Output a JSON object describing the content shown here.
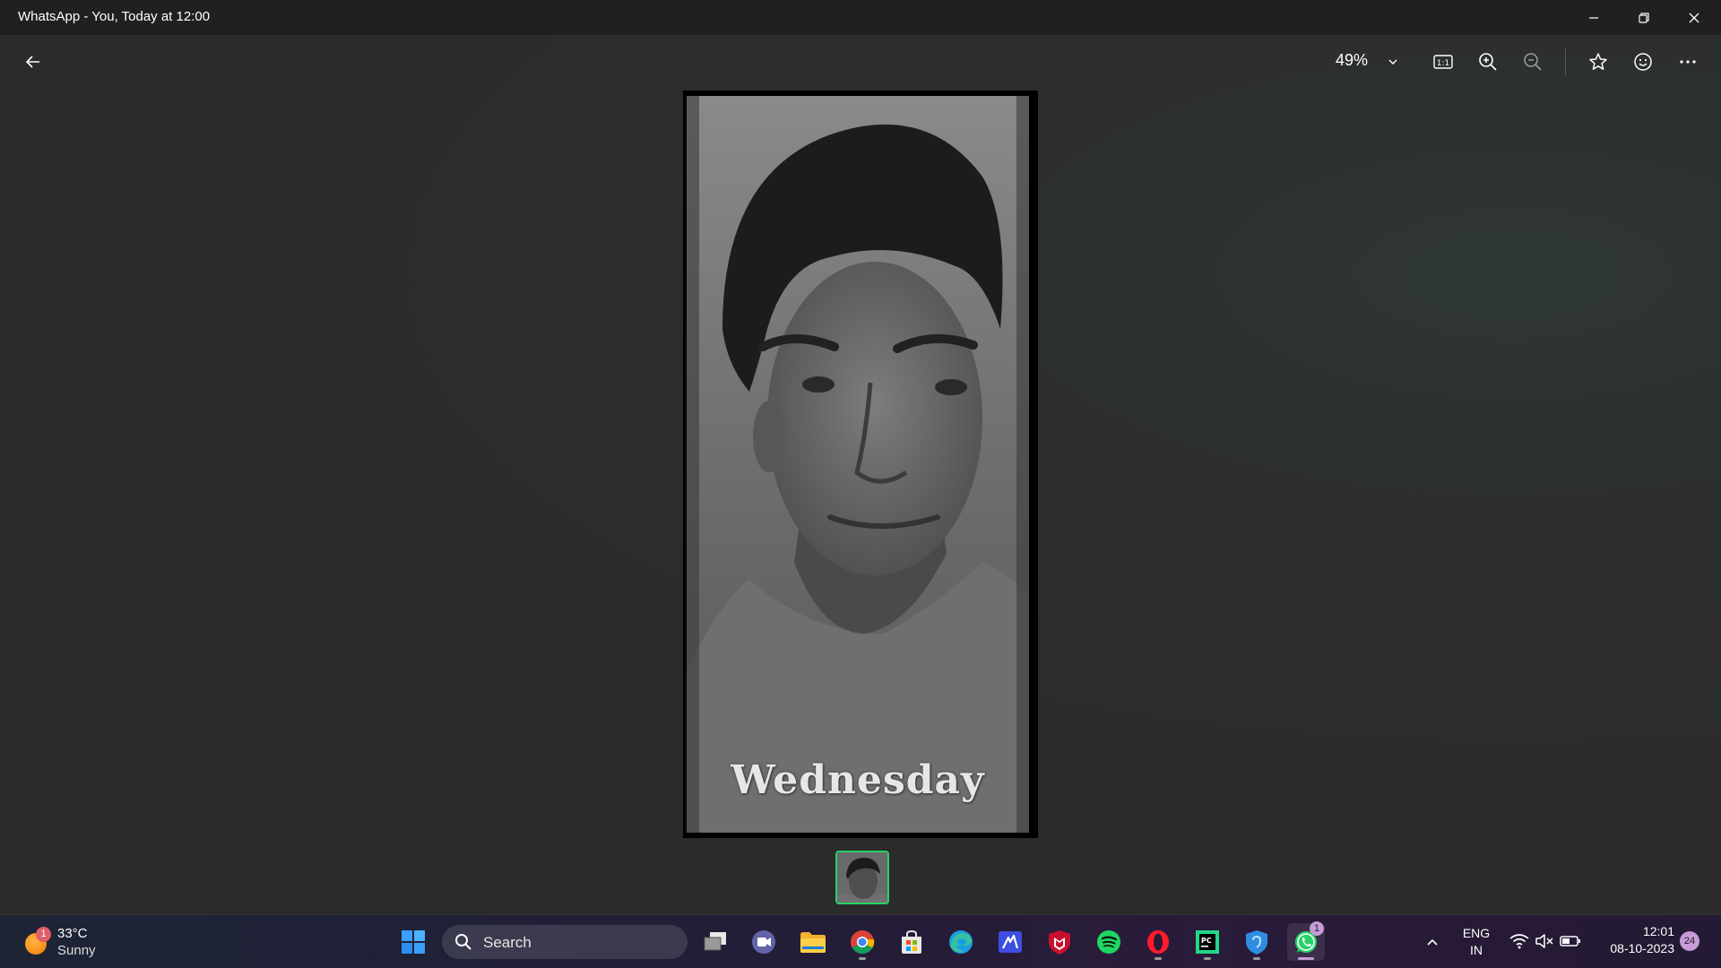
{
  "window": {
    "title": "WhatsApp - You, Today at 12:00"
  },
  "toolbar": {
    "zoom_level": "49%"
  },
  "photo": {
    "caption": "Wednesday"
  },
  "taskbar": {
    "weather": {
      "temperature": "33°C",
      "condition": "Sunny",
      "badge": "1"
    },
    "search_label": "Search",
    "whatsapp_badge": "1",
    "language_line1": "ENG",
    "language_line2": "IN",
    "clock_time": "12:01",
    "clock_date": "08-10-2023",
    "notification_count": "24"
  },
  "colors": {
    "accent_green": "#25d366",
    "taskbar_badge": "#c79bd8"
  }
}
